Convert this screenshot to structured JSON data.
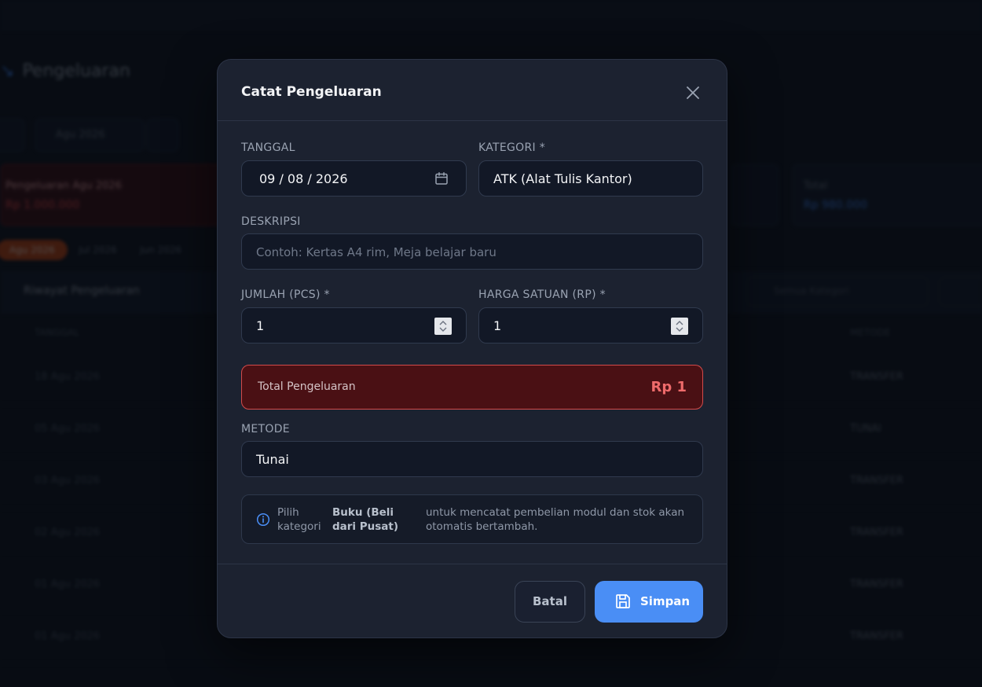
{
  "background": {
    "app_title": "Pengeluaran",
    "filter_date": "Agu 2026",
    "summary_red_label": "Pengeluaran Agu 2026",
    "summary_red_value": "Rp 1.000.000",
    "summary_card_label": "Total",
    "summary_card_value": "Rp 980.000",
    "pills": [
      "Agu 2026",
      "Jul 2026",
      "Jun 2026"
    ],
    "table_title": "Riwayat Pengeluaran",
    "table_search_placeholder": "Semua Kategori",
    "columns": [
      "TANGGAL",
      "METODE"
    ],
    "rows": [
      {
        "date": "18 Agu 2026",
        "method": "TRANSFER"
      },
      {
        "date": "05 Agu 2026",
        "method": "TUNAI"
      },
      {
        "date": "03 Agu 2026",
        "method": "TRANSFER"
      },
      {
        "date": "02 Agu 2026",
        "method": "TRANSFER"
      },
      {
        "date": "01 Agu 2026",
        "method": "TRANSFER"
      },
      {
        "date": "01 Agu 2026",
        "method": "TRANSFER"
      }
    ]
  },
  "modal": {
    "title": "Catat Pengeluaran",
    "tanggal_label": "TANGGAL",
    "tanggal_value": "09 / 08 / 2026",
    "kategori_label": "KATEGORI *",
    "kategori_value": "ATK (Alat Tulis Kantor)",
    "deskripsi_label": "DESKRIPSI",
    "deskripsi_placeholder": "Contoh: Kertas A4 rim, Meja belajar baru",
    "jumlah_label": "JUMLAH (PCS) *",
    "jumlah_value": "1",
    "harga_label": "HARGA SATUAN (RP) *",
    "harga_value": "1",
    "total_label": "Total Pengeluaran",
    "total_value": "Rp 1",
    "metode_label": "METODE",
    "metode_value": "Tunai",
    "info_part1": "Pilih kategori",
    "info_bold": "Buku (Beli dari Pusat)",
    "info_part2": "untuk mencatat pembelian modul dan stok akan otomatis bertambah.",
    "cancel_label": "Batal",
    "save_label": "Simpan"
  },
  "colors": {
    "accent": "#4a8ef5",
    "danger_bg": "#4a1014",
    "danger_border": "#d34b4b",
    "danger_text": "#ef6b6b",
    "modal_bg": "#1c2230"
  },
  "icons": {
    "close": "close-icon",
    "calendar": "calendar-icon",
    "info": "info-icon",
    "save": "save-icon",
    "spinner": "spinner-arrows-icon"
  }
}
